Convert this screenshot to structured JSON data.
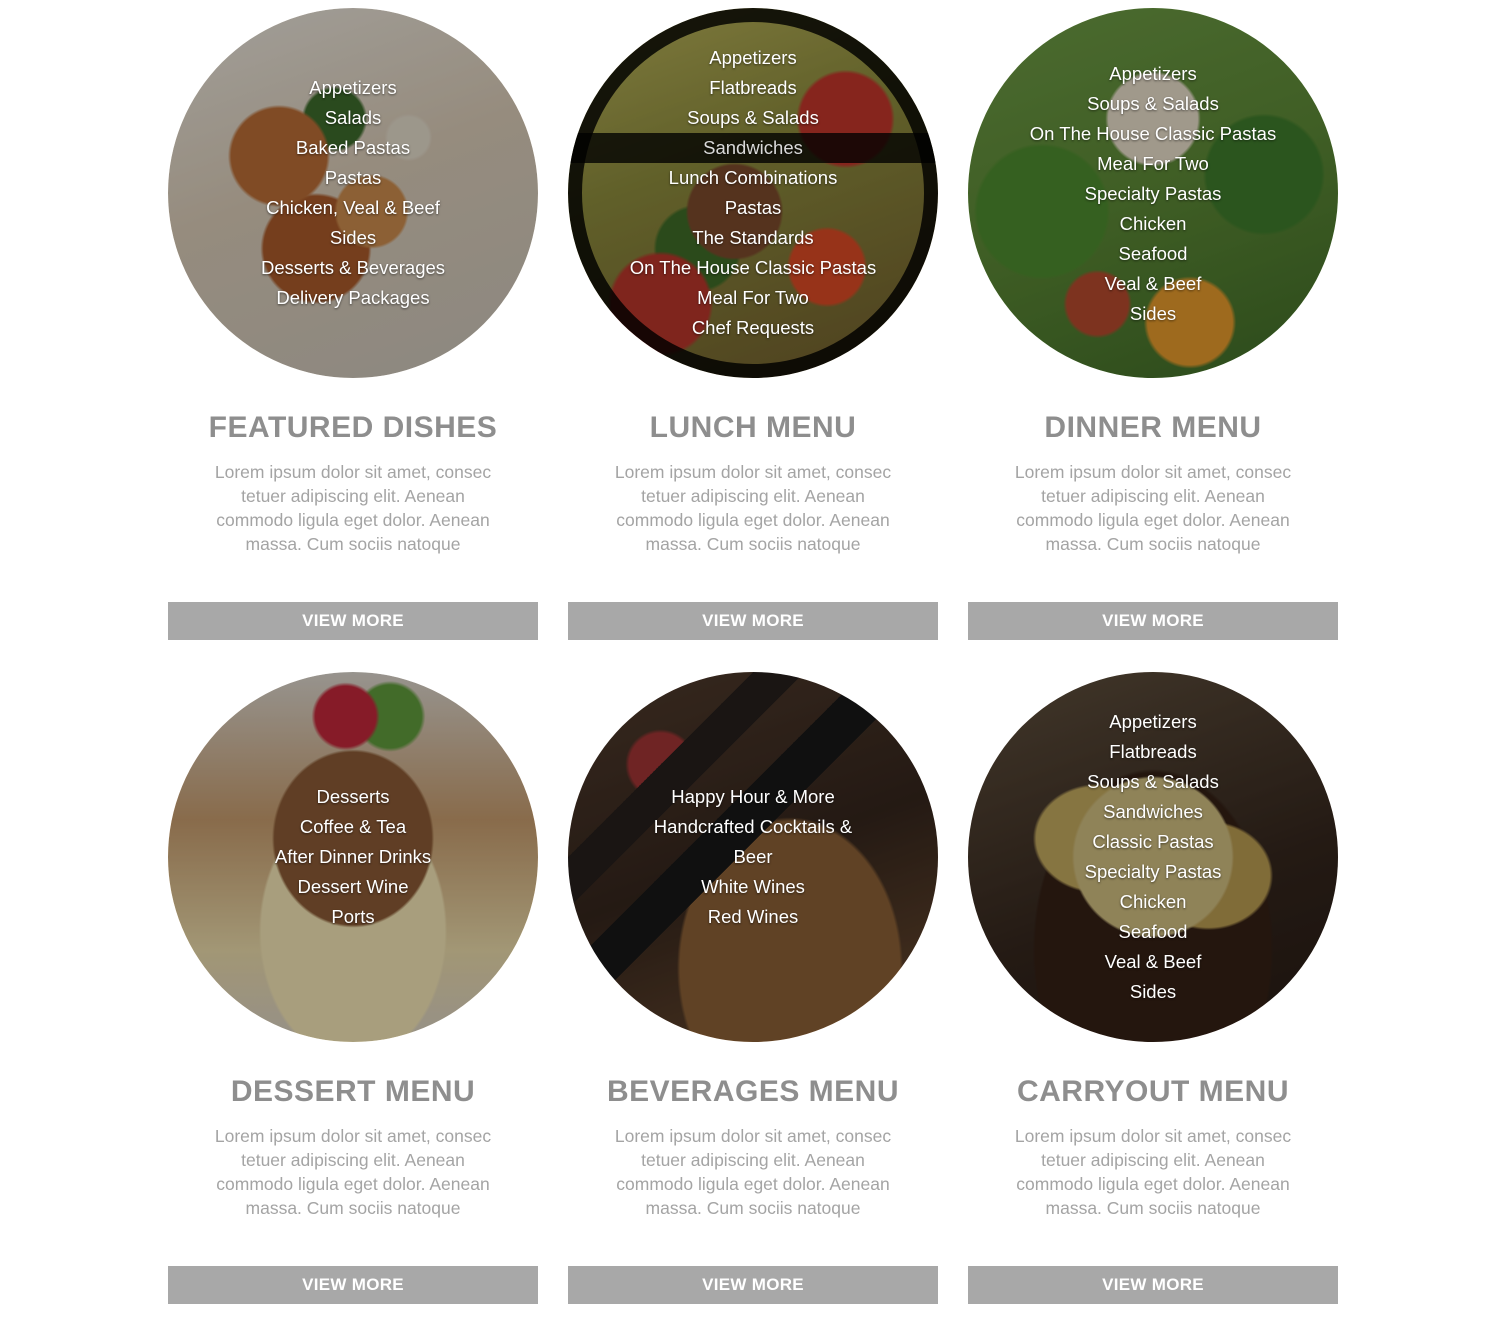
{
  "cards": [
    {
      "title": "FEATURED DISHES",
      "description": "Lorem ipsum dolor sit amet, consec tetuer adipiscing elit. Aenean commodo ligula eget dolor. Aenean massa. Cum sociis natoque",
      "button": "VIEW MORE",
      "menu": [
        "Appetizers",
        "Salads",
        "Baked Pastas",
        "Pastas",
        "Chicken, Veal & Beef",
        "Sides",
        "Desserts & Beverages",
        "Delivery Packages"
      ]
    },
    {
      "title": "LUNCH MENU",
      "description": "Lorem ipsum dolor sit amet, consec tetuer adipiscing elit. Aenean commodo ligula eget dolor. Aenean massa. Cum sociis natoque",
      "button": "VIEW MORE",
      "menu": [
        "Appetizers",
        "Flatbreads",
        "Soups & Salads",
        "Sandwiches",
        "Lunch Combinations",
        "Pastas",
        "The Standards",
        "On The House Classic Pastas",
        "Meal For Two",
        "Chef Requests"
      ],
      "hovered_item": "Sandwiches"
    },
    {
      "title": "DINNER MENU",
      "description": "Lorem ipsum dolor sit amet, consec tetuer adipiscing elit. Aenean commodo ligula eget dolor. Aenean massa. Cum sociis natoque",
      "button": "VIEW MORE",
      "menu": [
        "Appetizers",
        "Soups & Salads",
        "On The House Classic Pastas",
        "Meal For Two",
        "Specialty Pastas",
        "Chicken",
        "Seafood",
        "Veal & Beef",
        "Sides"
      ]
    },
    {
      "title": "DESSERT MENU",
      "description": "Lorem ipsum dolor sit amet, consec tetuer adipiscing elit. Aenean commodo ligula eget dolor. Aenean massa. Cum sociis natoque",
      "button": "VIEW MORE",
      "menu": [
        "Desserts",
        "Coffee & Tea",
        "After Dinner Drinks",
        "Dessert Wine",
        "Ports"
      ]
    },
    {
      "title": "BEVERAGES MENU",
      "description": "Lorem ipsum dolor sit amet, consec tetuer adipiscing elit. Aenean commodo ligula eget dolor. Aenean massa. Cum sociis natoque",
      "button": "VIEW MORE",
      "menu": [
        "Happy Hour & More",
        "Handcrafted Cocktails &",
        "Beer",
        "White Wines",
        "Red Wines"
      ]
    },
    {
      "title": "CARRYOUT MENU",
      "description": "Lorem ipsum dolor sit amet, consec tetuer adipiscing elit. Aenean commodo ligula eget dolor. Aenean massa. Cum sociis natoque",
      "button": "VIEW MORE",
      "menu": [
        "Appetizers",
        "Flatbreads",
        "Soups & Salads",
        "Sandwiches",
        "Classic Pastas",
        "Specialty Pastas",
        "Chicken",
        "Seafood",
        "Veal & Beef",
        "Sides"
      ]
    }
  ],
  "colors": {
    "title": "#8e8e8e",
    "description": "#a4a4a4",
    "button_bg": "#a8a8a8",
    "button_text": "#ffffff"
  }
}
